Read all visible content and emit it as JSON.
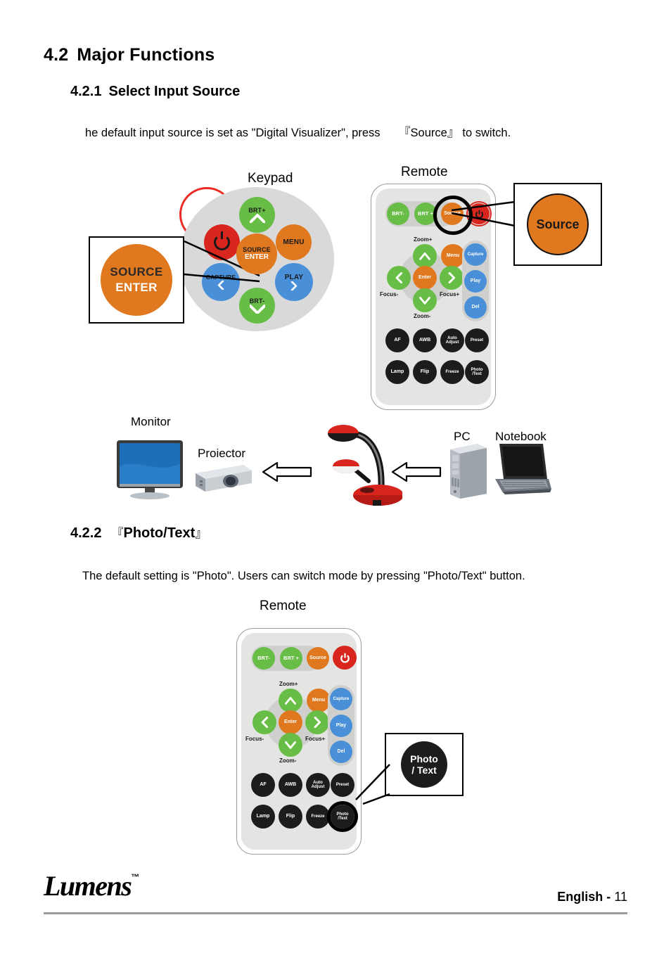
{
  "section": {
    "number": "4.2",
    "title": "Major Functions"
  },
  "sub1": {
    "number": "4.2.1",
    "title": "Select Input Source",
    "body_pre": "he default input source is set as \"Digital Visualizer\", press",
    "bracket_open": "『",
    "body_key": "Source",
    "bracket_close": "』",
    "body_post": "to switch."
  },
  "sub2": {
    "number": "4.2.2",
    "bracket_open": "『",
    "title": "Photo/Text",
    "bracket_close": "』",
    "body": "The default setting is \"Photo\". Users can switch mode by pressing \"Photo/Text\" button."
  },
  "labels": {
    "keypad": "Keypad",
    "remote_top": "Remote",
    "remote_bottom": "Remote",
    "monitor": "Monitor",
    "projector": "Proiector",
    "pc": "PC",
    "notebook": "Notebook"
  },
  "callouts": {
    "source_enter_line1": "SOURCE",
    "source_enter_line2": "ENTER",
    "remote_source": "Source",
    "photo_text_line1": "Photo",
    "photo_text_line2": "/ Text"
  },
  "keypad": {
    "buttons": [
      {
        "name": "power",
        "label": "",
        "color": "#d8251d"
      },
      {
        "name": "brt-up",
        "label": "BRT+",
        "color": "#67bd45"
      },
      {
        "name": "menu",
        "label": "MENU",
        "color": "#e0781f"
      },
      {
        "name": "source",
        "label": "SOURCE",
        "label2": "ENTER",
        "color": "#e0781f"
      },
      {
        "name": "capture",
        "label": "CAPTURE",
        "color": "#4a90d9"
      },
      {
        "name": "play",
        "label": "PLAY",
        "color": "#4a90d9"
      },
      {
        "name": "brt-dn",
        "label": "BRT-",
        "color": "#67bd45"
      }
    ]
  },
  "remote": {
    "row1": [
      {
        "name": "brt-minus",
        "label": "BRT-",
        "color": "#67bd45"
      },
      {
        "name": "brt-plus",
        "label": "BRT +",
        "color": "#67bd45"
      },
      {
        "name": "source",
        "label": "Source",
        "color": "#e0781f"
      },
      {
        "name": "power",
        "label": "",
        "color": "#d8251d"
      }
    ],
    "dpad": {
      "up": "",
      "down": "",
      "left": "",
      "right": "",
      "center": "Enter",
      "tag_up": "Zoom+",
      "tag_down": "Zoom-",
      "tag_left": "Focus-",
      "tag_right": "Focus+"
    },
    "menu": "Menu",
    "side": [
      {
        "name": "capture",
        "label": "Capture",
        "color": "#4a90d9"
      },
      {
        "name": "play",
        "label": "Play",
        "color": "#4a90d9"
      },
      {
        "name": "del",
        "label": "Del",
        "color": "#4a90d9"
      }
    ],
    "row_af": [
      {
        "name": "af",
        "label": "AF"
      },
      {
        "name": "awb",
        "label": "AWB"
      },
      {
        "name": "auto-adjust",
        "label": "Auto",
        "label2": "Adjust"
      },
      {
        "name": "preset",
        "label": "Preset"
      }
    ],
    "row_lamp": [
      {
        "name": "lamp",
        "label": "Lamp"
      },
      {
        "name": "flip",
        "label": "Flip"
      },
      {
        "name": "freeze",
        "label": "Freeze"
      },
      {
        "name": "photo-text",
        "label": "Photo",
        "label2": "/Text"
      }
    ]
  },
  "footer": {
    "logo": "Lumens",
    "tm": "™",
    "language": "English",
    "separator": "-",
    "page": "11"
  },
  "colors": {
    "orange": "#e0781f",
    "green": "#67bd45",
    "blue": "#4a90d9",
    "red": "#d8251d",
    "dark": "#1c1c1c",
    "remote_body": "#e4e4e2",
    "keypad_disc": "#d9d9d9"
  }
}
